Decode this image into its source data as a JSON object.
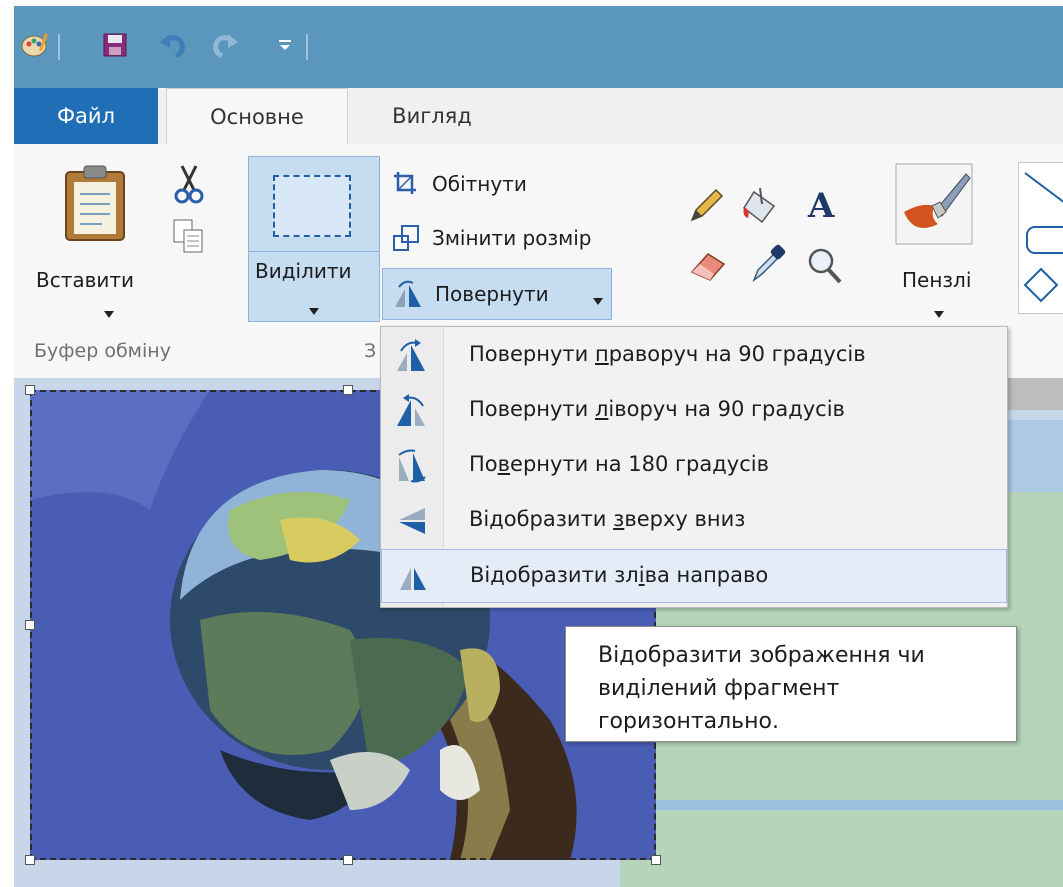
{
  "tabs": {
    "file": "Файл",
    "home": "Основне",
    "view": "Вигляд"
  },
  "ribbon": {
    "paste": "Вставити",
    "select": "Виділити",
    "crop": "Обітнути",
    "resize": "Змінити розмір",
    "rotate": "Повернути",
    "brushes": "Пензлі",
    "clipboard_group": "Буфер обміну",
    "image_group_partial": "З"
  },
  "rotate_menu": {
    "items": [
      {
        "pre": "Повернути ",
        "ul": "п",
        "post": "раворуч на 90 градусів"
      },
      {
        "pre": "Повернути ",
        "ul": "л",
        "post": "іворуч на 90 градусів"
      },
      {
        "pre": "По",
        "ul": "в",
        "post": "ернути на 180 градусів"
      },
      {
        "pre": "Відобразити ",
        "ul": "з",
        "post": "верху вниз"
      },
      {
        "pre": "Відобразити зл",
        "ul": "і",
        "post": "ва направо"
      }
    ]
  },
  "tooltip": {
    "text": "Відобразити зображення чи\nвиділений фрагмент\nгоризонтально."
  },
  "colors": {
    "title_bar": "#5b97bd",
    "file_tab": "#1f6eb6",
    "selection_highlight": "#c6dcf1",
    "menu_hover": "#e4edf7"
  },
  "icons": [
    "paint-app-icon",
    "save-icon",
    "undo-icon",
    "redo-icon",
    "customize-qat-icon",
    "clipboard-icon",
    "scissors-icon",
    "copy-icon",
    "crop-icon",
    "resize-icon",
    "rotate-icon",
    "pencil-icon",
    "fill-bucket-icon",
    "text-icon",
    "eraser-icon",
    "color-picker-icon",
    "magnifier-icon",
    "brush-icon",
    "shape-line-icon",
    "shape-rounded-rect-icon",
    "shape-diamond-icon"
  ]
}
